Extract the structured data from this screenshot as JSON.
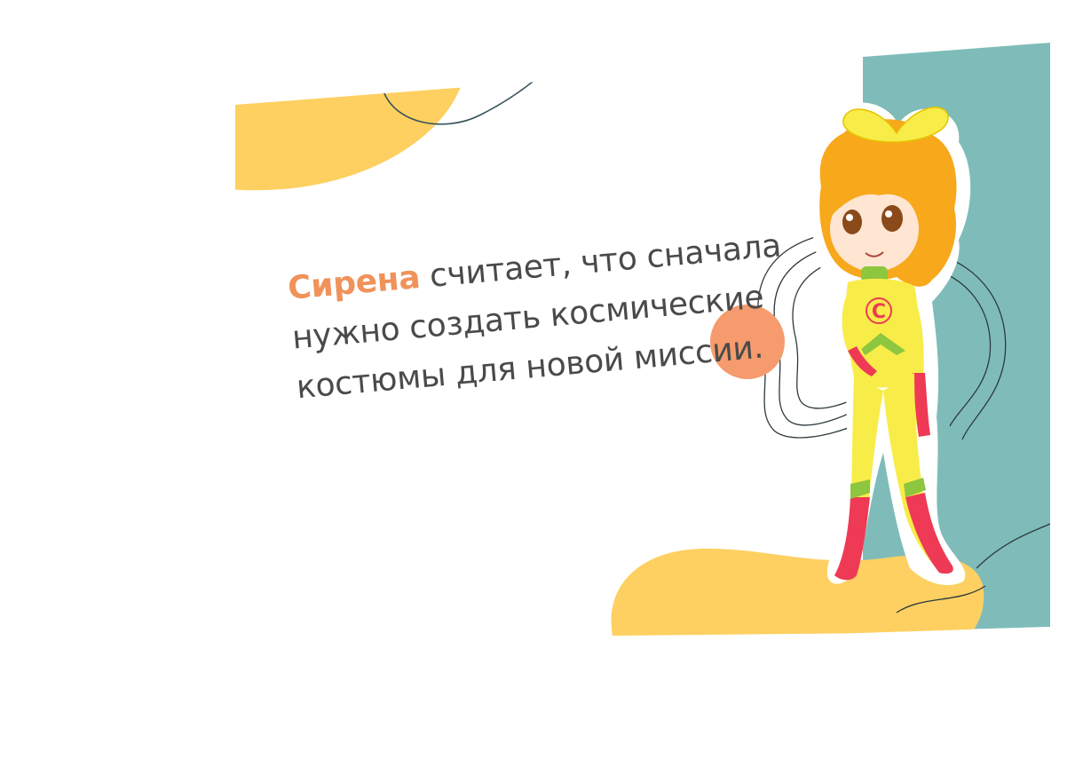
{
  "slide": {
    "text": {
      "highlight_name": "Сирена",
      "line1_rest": " считает, что сначала",
      "line2": "нужно создать космические",
      "line3": "костюмы для новой миссии."
    },
    "colors": {
      "name_accent": "#f0925a",
      "body_text": "#4a4a4a",
      "teal_panel": "#7fbcb9",
      "yellow_blob": "#fdd061",
      "orange_dot": "#f59b6d",
      "suit_yellow": "#f8ec48",
      "suit_red": "#ee3a55",
      "suit_green": "#8dc63f",
      "hair_orange": "#f7a81b"
    },
    "illustration": {
      "character": "superhero-girl",
      "emblem": "C"
    }
  }
}
